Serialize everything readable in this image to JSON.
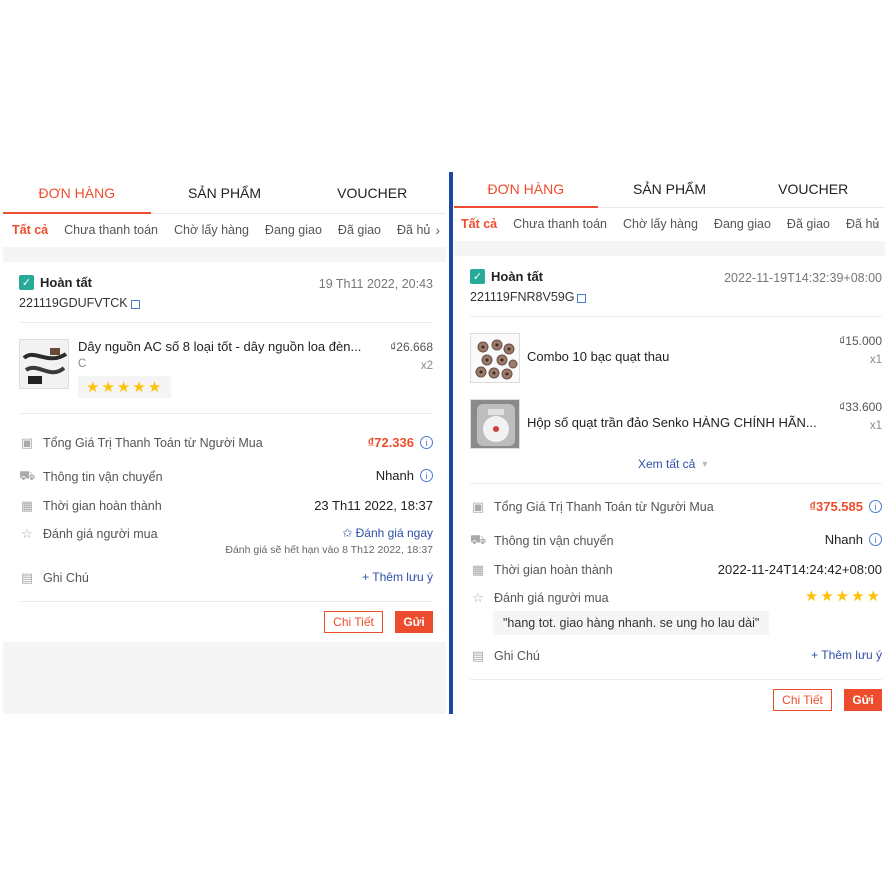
{
  "left": {
    "tabs": [
      "ĐƠN HÀNG",
      "SẢN PHẨM",
      "VOUCHER"
    ],
    "subtabs": [
      "Tất cả",
      "Chưa thanh toán",
      "Chờ lấy hàng",
      "Đang giao",
      "Đã giao",
      "Đã hủ"
    ],
    "status": "Hoàn tất",
    "datetime": "19 Th11 2022, 20:43",
    "order_id": "221119GDUFVTCK",
    "product": {
      "name": "Dây nguồn AC số 8 loại tốt - dây nguồn loa đèn...",
      "variant": "C",
      "price": "₫26.668",
      "qty": "x2",
      "rating": 5
    },
    "total_label": "Tổng Giá Trị Thanh Toán từ Người Mua",
    "total_value": "₫72.336",
    "shipping_label": "Thông tin vận chuyển",
    "shipping_value": "Nhanh",
    "completed_label": "Thời gian hoàn thành",
    "completed_value": "23 Th11 2022, 18:37",
    "rate_label": "Đánh giá người mua",
    "rate_action": "Đánh giá ngay",
    "rate_expiry": "Đánh giá sẽ hết hạn vào 8 Th12 2022, 18:37",
    "note_label": "Ghi Chú",
    "note_action": "+ Thêm lưu ý",
    "detail_button": "Chi Tiết",
    "send_button": "Gửi"
  },
  "right": {
    "tabs": [
      "ĐƠN HÀNG",
      "SẢN PHẨM",
      "VOUCHER"
    ],
    "subtabs": [
      "Tất cả",
      "Chưa thanh toán",
      "Chờ lấy hàng",
      "Đang giao",
      "Đã giao",
      "Đã hủ"
    ],
    "status": "Hoàn tất",
    "datetime": "2022-11-19T14:32:39+08:00",
    "order_id": "221119FNR8V59G",
    "products": [
      {
        "name": "Combo 10 bạc quạt thau",
        "price": "₫15.000",
        "qty": "x1"
      },
      {
        "name": "Hộp số quạt trần đảo Senko HÀNG CHÍNH HÃN...",
        "price": "₫33.600",
        "qty": "x1"
      }
    ],
    "see_all": "Xem tất cả",
    "total_label": "Tổng Giá Trị Thanh Toán từ Người Mua",
    "total_value": "₫375.585",
    "shipping_label": "Thông tin vận chuyển",
    "shipping_value": "Nhanh",
    "completed_label": "Thời gian hoàn thành",
    "completed_value": "2022-11-24T14:24:42+08:00",
    "rate_label": "Đánh giá người mua",
    "rating": 5,
    "review_text": "\"hang tot. giao hàng nhanh. se ung ho lau dài\"",
    "note_label": "Ghi Chú",
    "note_action": "+ Thêm lưu ý",
    "detail_button": "Chi Tiết",
    "send_button": "Gửi"
  },
  "colors": {
    "accent": "#ee4d2d",
    "link": "#2f4fa8",
    "divider": "#1e47a6",
    "star": "#ffc107",
    "status": "#26aa99"
  },
  "icons": [
    "check-square-icon",
    "copy-icon",
    "info-icon",
    "truck-icon",
    "calendar-icon",
    "star-outline-icon",
    "note-icon",
    "chevron-right-icon",
    "chevron-down-icon"
  ]
}
